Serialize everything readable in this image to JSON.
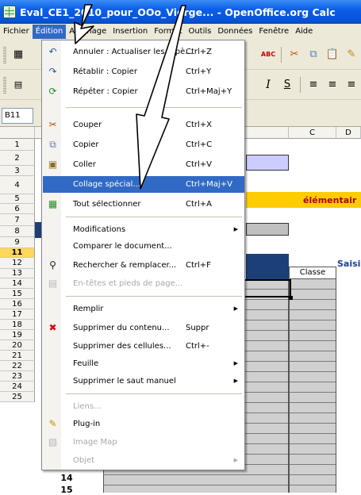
{
  "window": {
    "title": "Eval_CE1_2010_pour_OOo_Vierge... - OpenOffice.org Calc"
  },
  "menubar": [
    "Fichier",
    "Édition",
    "Affichage",
    "Insertion",
    "Format",
    "Outils",
    "Données",
    "Fenêtre",
    "Aide"
  ],
  "namebox": "B11",
  "grid": {
    "columns": [
      "C",
      "D"
    ],
    "rows": [
      "1",
      "2",
      "3",
      "4",
      "5",
      "6",
      "7",
      "8",
      "9",
      "11",
      "12",
      "13",
      "14",
      "15",
      "16",
      "17",
      "18",
      "19",
      "20",
      "21",
      "22",
      "23",
      "24",
      "25"
    ],
    "labels": {
      "elementaire": "élémentair",
      "saisi": "Saisi",
      "classe": "Classe"
    },
    "values": {
      "row24": "14",
      "row25": "15"
    }
  },
  "edit_menu": {
    "undo": {
      "label": "Annuler : Actualiser les repè...",
      "shortcut": "Ctrl+Z"
    },
    "redo": {
      "label": "Rétablir : Copier",
      "shortcut": "Ctrl+Y"
    },
    "repeat": {
      "label": "Répéter : Copier",
      "shortcut": "Ctrl+Maj+Y"
    },
    "cut": {
      "label": "Couper",
      "shortcut": "Ctrl+X"
    },
    "copy": {
      "label": "Copier",
      "shortcut": "Ctrl+C"
    },
    "paste": {
      "label": "Coller",
      "shortcut": "Ctrl+V"
    },
    "paste_special": {
      "label": "Collage spécial...",
      "shortcut": "Ctrl+Maj+V"
    },
    "select_all": {
      "label": "Tout sélectionner",
      "shortcut": "Ctrl+A"
    },
    "changes": {
      "label": "Modifications"
    },
    "compare": {
      "label": "Comparer le document..."
    },
    "find_replace": {
      "label": "Rechercher & remplacer...",
      "shortcut": "Ctrl+F"
    },
    "headers_footers": {
      "label": "En-têtes et pieds de page..."
    },
    "fill": {
      "label": "Remplir"
    },
    "delete_contents": {
      "label": "Supprimer du contenu...",
      "shortcut": "Suppr"
    },
    "delete_cells": {
      "label": "Supprimer des cellules...",
      "shortcut": "Ctrl+-"
    },
    "sheet": {
      "label": "Feuille"
    },
    "delete_break": {
      "label": "Supprimer le saut manuel"
    },
    "links": {
      "label": "Liens..."
    },
    "plugin": {
      "label": "Plug-in"
    },
    "image_map": {
      "label": "Image Map"
    },
    "object": {
      "label": "Objet"
    }
  },
  "colors": {
    "highlight": "#316ac5",
    "yellow_band": "#ffcc00",
    "lavender": "#ccccff",
    "dark_blue": "#1c3f7a"
  }
}
